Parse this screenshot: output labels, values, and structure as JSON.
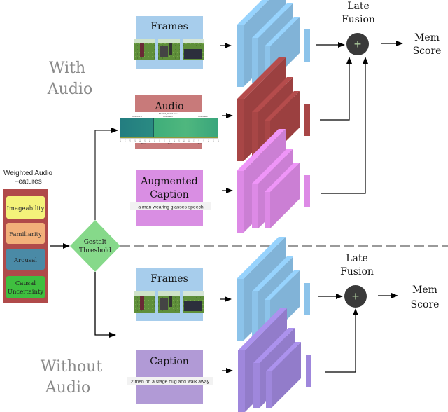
{
  "sections": {
    "with_audio": {
      "line1": "With",
      "line2": "Audio"
    },
    "without_audio": {
      "line1": "Without",
      "line2": "Audio"
    }
  },
  "weighted_features": {
    "title_line1": "Weighted Audio",
    "title_line2": "Features",
    "panel_color": "#b04a4a",
    "items": [
      {
        "label": "Imageability",
        "color": "#f4f27a"
      },
      {
        "label": "Familiarity",
        "color": "#f2b07a"
      },
      {
        "label": "Arousal",
        "color": "#4a8aa6"
      },
      {
        "label": "Causal",
        "label2": "Uncertainty",
        "color": "#3fbf3f"
      }
    ]
  },
  "gestalt": {
    "line1": "Gestalt",
    "line2": "Threshold",
    "color": "#86d98a"
  },
  "top_inputs": {
    "frames": {
      "label": "Frames",
      "color": "#a7cdec"
    },
    "audio": {
      "label": "Audio",
      "color": "#c87a7a",
      "spectrogram": {
        "header": "S17384_02484.wav",
        "channels": [
          "Channel 0",
          "Channel 1",
          "Channel 2"
        ],
        "axis_labels": [
          "Time",
          "Time",
          "Time"
        ],
        "ticks": [
          "0",
          "1",
          "2",
          "3",
          "4",
          "5",
          "6",
          "0",
          "1",
          "2",
          "3",
          "4",
          "5",
          "6",
          "0",
          "1",
          "2",
          "3",
          "4",
          "5",
          "6"
        ]
      }
    },
    "augmented_caption": {
      "line1": "Augmented",
      "line2": "Caption",
      "caption_text": "a man wearing glasses speech",
      "color": "#d98ee3"
    }
  },
  "bottom_inputs": {
    "frames": {
      "label": "Frames",
      "color": "#a7cdec"
    },
    "caption": {
      "label": "Caption",
      "caption_text": "2 men on a stage hug and walk away",
      "color": "#b19ad6"
    }
  },
  "networks": {
    "frames_color": "#8cc3ea",
    "audio_color": "#a84646",
    "aug_caption_color": "#dd8ae6",
    "caption_color": "#9f87dc"
  },
  "fusion": {
    "top": {
      "line1": "Late",
      "line2": "Fusion",
      "symbol": "+"
    },
    "bottom": {
      "line1": "Late",
      "line2": "Fusion",
      "symbol": "+"
    }
  },
  "outputs": {
    "top": {
      "line1": "Mem",
      "line2": "Score"
    },
    "bottom": {
      "line1": "Mem",
      "line2": "Score"
    }
  }
}
